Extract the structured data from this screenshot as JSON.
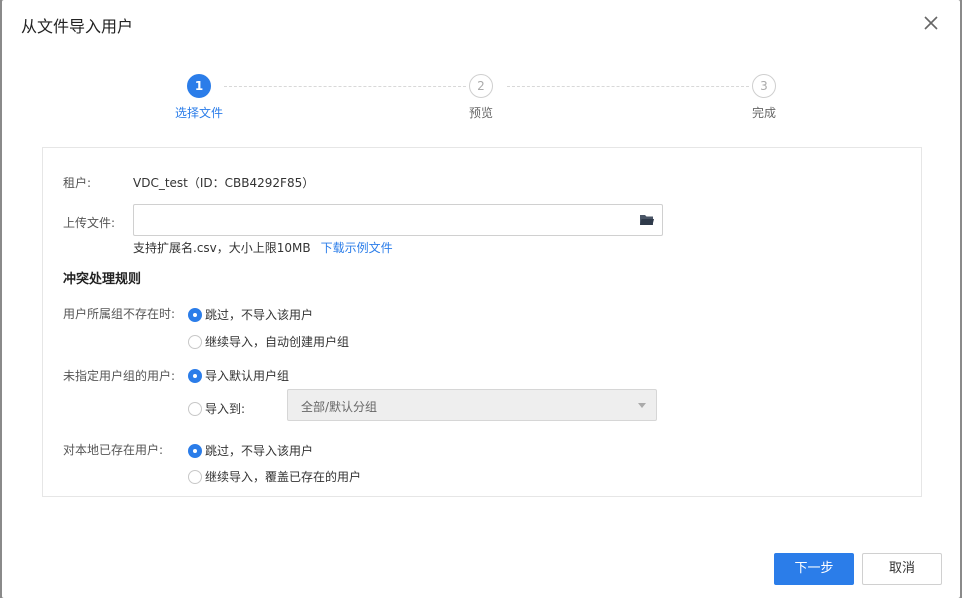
{
  "dialog": {
    "title": "从文件导入用户"
  },
  "steps": [
    {
      "number": "1",
      "label": "选择文件",
      "state": "active"
    },
    {
      "number": "2",
      "label": "预览",
      "state": "pending"
    },
    {
      "number": "3",
      "label": "完成",
      "state": "pending"
    }
  ],
  "form": {
    "tenant_label": "租户:",
    "tenant_value": "VDC_test（ID：CBB4292F85）",
    "upload_label": "上传文件:",
    "upload_value": "",
    "upload_hint": "支持扩展名.csv，大小上限10MB",
    "download_link": "下载示例文件"
  },
  "rules": {
    "section_title": "冲突处理规则",
    "group_missing": {
      "label": "用户所属组不存在时:",
      "options": [
        "跳过，不导入该用户",
        "继续导入，自动创建用户组"
      ],
      "selected": 0
    },
    "no_group": {
      "label": "未指定用户组的用户:",
      "options": [
        "导入默认用户组",
        "导入到:"
      ],
      "selected": 0,
      "target_select_value": "全部/默认分组"
    },
    "existing_user": {
      "label": "对本地已存在用户:",
      "options": [
        "跳过，不导入该用户",
        "继续导入，覆盖已存在的用户"
      ],
      "selected": 0
    }
  },
  "footer": {
    "next_label": "下一步",
    "cancel_label": "取消"
  },
  "colors": {
    "accent": "#2b7de9"
  },
  "icons": {
    "close": "close-icon",
    "folder": "folder-icon",
    "dropdown": "chevron-down-icon"
  }
}
